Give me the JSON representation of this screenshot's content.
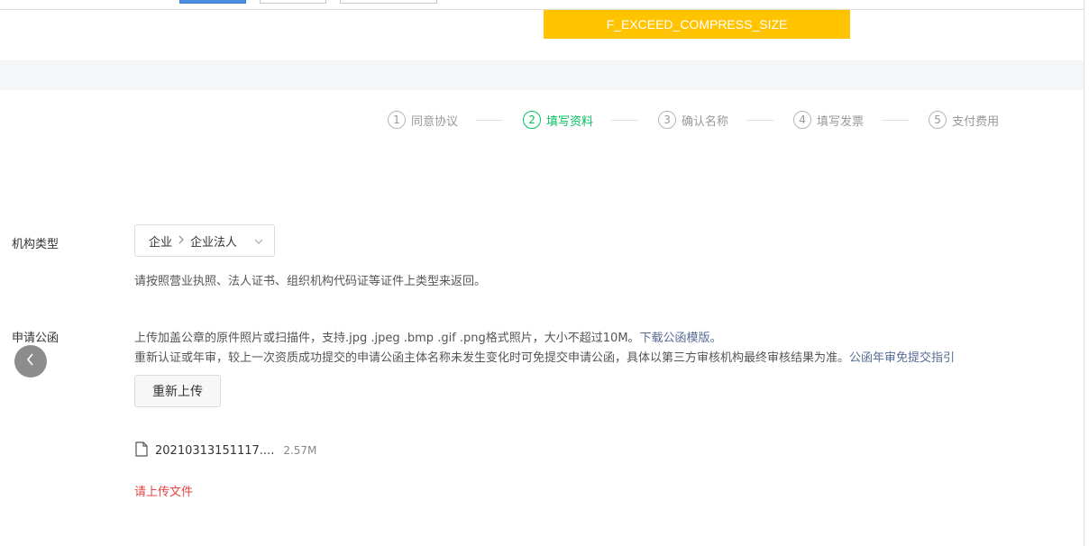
{
  "toast": {
    "text": "F_EXCEED_COMPRESS_SIZE",
    "color": "#ffc300"
  },
  "steps": [
    {
      "num": "1",
      "label": "同意协议",
      "active": false
    },
    {
      "num": "2",
      "label": "填写资料",
      "active": true
    },
    {
      "num": "3",
      "label": "确认名称",
      "active": false
    },
    {
      "num": "4",
      "label": "填写发票",
      "active": false
    },
    {
      "num": "5",
      "label": "支付费用",
      "active": false
    }
  ],
  "org_type": {
    "label": "机构类型",
    "value_level1": "企业",
    "value_level2": "企业法人",
    "hint": "请按照营业执照、法人证书、组织机构代码证等证件上类型来返回。"
  },
  "letter": {
    "label": "申请公函",
    "hint_line1": "上传加盖公章的原件照片或扫描件，支持.jpg .jpeg .bmp .gif .png格式照片，大小不超过10M。",
    "download_link": "下载公函模版。",
    "hint_line2": "重新认证或年审，较上一次资质成功提交的申请公函主体名称未发生变化时可免提交申请公函，具体以第三方审核机构最终审核结果为准。",
    "guide_link": "公函年审免提交指引",
    "reupload_label": "重新上传",
    "file_name": "20210313151117....",
    "file_size": "2.57M",
    "error": "请上传文件"
  },
  "colors": {
    "accent_green": "#07c160",
    "link": "#576b95",
    "error": "#e64340"
  }
}
